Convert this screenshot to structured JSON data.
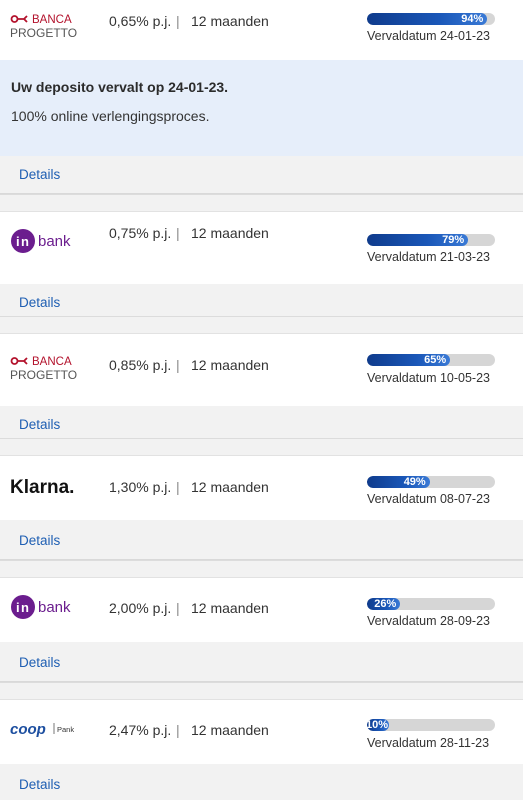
{
  "first_notice": {
    "title": "Uw deposito vervalt op 24-01-23.",
    "text": "100% online verlengingsproces."
  },
  "details_label": "Details",
  "separator": "|",
  "deposits": [
    {
      "bank": "Banca Progetto",
      "logo_icon": "banca-progetto-logo",
      "logo_text_line1": "BANCA",
      "logo_text_line2": "PROGETTO",
      "rate": "0,65% p.j.",
      "term": "12 maanden",
      "progress_label": "94%",
      "progress_value": 0.94,
      "expiry": "Vervaldatum 24-01-23"
    },
    {
      "bank": "inbank",
      "logo_icon": "inbank-logo",
      "logo_text_line1": "bank",
      "rate": "0,75% p.j.",
      "term": "12 maanden",
      "progress_label": "79%",
      "progress_value": 0.79,
      "expiry": "Vervaldatum 21-03-23"
    },
    {
      "bank": "Banca Progetto",
      "logo_icon": "banca-progetto-logo",
      "logo_text_line1": "BANCA",
      "logo_text_line2": "PROGETTO",
      "rate": "0,85% p.j.",
      "term": "12 maanden",
      "progress_label": "65%",
      "progress_value": 0.65,
      "expiry": "Vervaldatum 10-05-23"
    },
    {
      "bank": "Klarna",
      "logo_icon": "klarna-logo",
      "logo_text_line1": "Klarna.",
      "rate": "1,30% p.j.",
      "term": "12 maanden",
      "progress_label": "49%",
      "progress_value": 0.49,
      "expiry": "Vervaldatum 08-07-23"
    },
    {
      "bank": "inbank",
      "logo_icon": "inbank-logo",
      "logo_text_line1": "bank",
      "rate": "2,00% p.j.",
      "term": "12 maanden",
      "progress_label": "26%",
      "progress_value": 0.26,
      "expiry": "Vervaldatum 28-09-23"
    },
    {
      "bank": "Coop Pank",
      "logo_icon": "coop-pank-logo",
      "logo_text_line1": "coop",
      "logo_text_line2": "Pank",
      "rate": "2,47% p.j.",
      "term": "12 maanden",
      "progress_label": "10%",
      "progress_value": 0.1,
      "expiry": "Vervaldatum 28-11-23"
    }
  ],
  "colors": {
    "progress_fill": "#1a57b8",
    "progress_track": "#d6d6d6",
    "link": "#1f5fb3",
    "notice_bg": "#e6eefa",
    "inbank": "#6b1d8e",
    "banca_red": "#b3122c",
    "coop_blue": "#1d4fa0"
  }
}
